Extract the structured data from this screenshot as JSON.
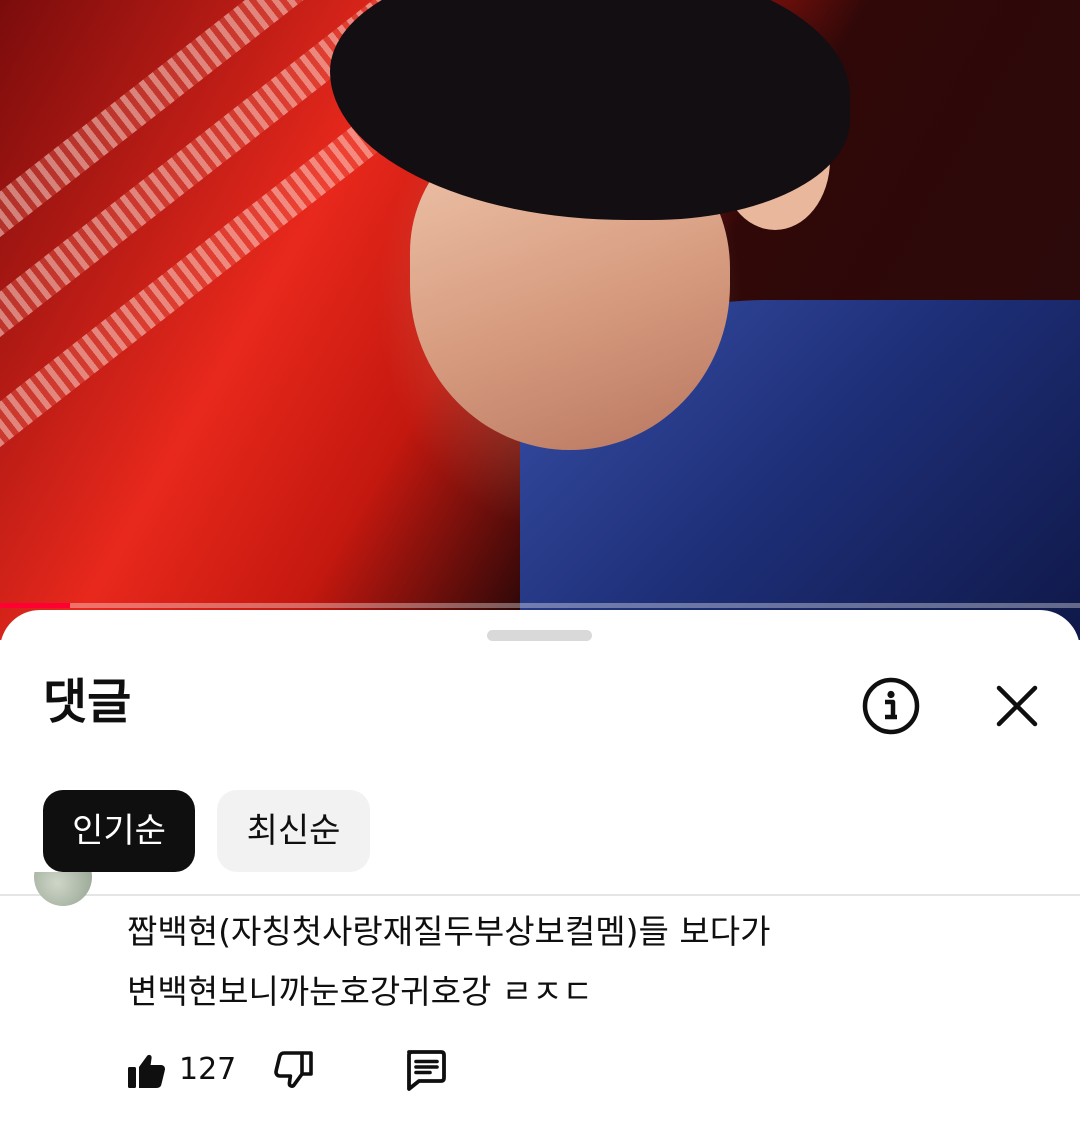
{
  "video": {
    "progress_fraction": 0.065
  },
  "comments_panel": {
    "title": "댓글",
    "sort_chips": [
      {
        "label": "인기순",
        "selected": true
      },
      {
        "label": "최신순",
        "selected": false
      }
    ],
    "icons": {
      "info": "info-circle-icon",
      "close": "close-icon"
    }
  },
  "comment": {
    "text_lines": [
      "짭백현(자칭첫사랑재질두부상보컬멤)들 보다가",
      "변백현보니까눈호강귀호강 ㄹㅈㄷ"
    ],
    "like_count": "127",
    "icons": {
      "like": "thumbs-up-icon",
      "dislike": "thumbs-down-icon",
      "reply": "reply-icon"
    }
  },
  "colors": {
    "accent": "#ff0033",
    "chip_active_bg": "#0f0f0f",
    "chip_inactive_bg": "#f2f2f2",
    "text": "#0f0f0f"
  }
}
